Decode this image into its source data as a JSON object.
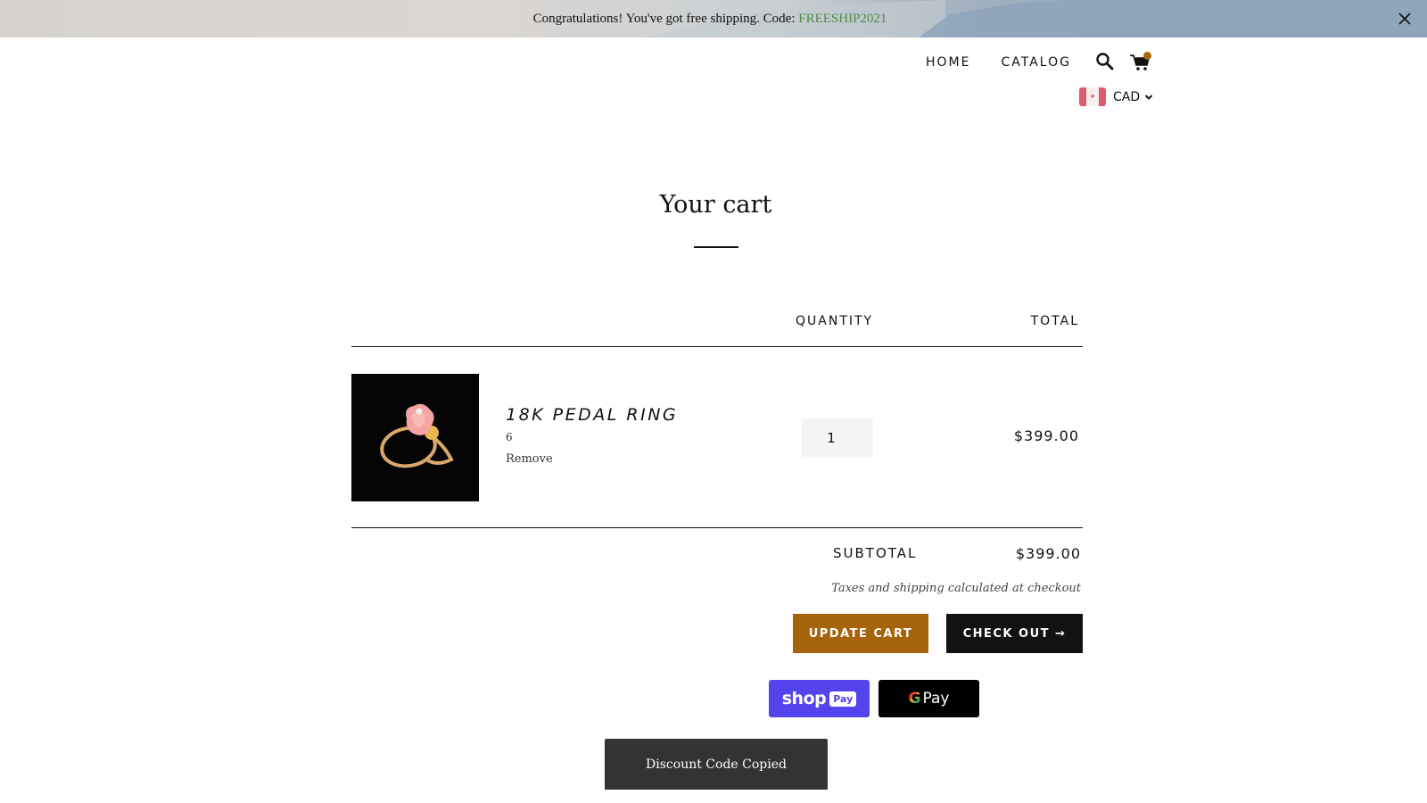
{
  "announcement": {
    "text": "Congratulations! You've got free shipping. Code: ",
    "code": "FREESHIP2021",
    "code_color": "#4f8b45",
    "close_icon": "close-icon"
  },
  "header": {
    "nav": [
      {
        "label": "HOME"
      },
      {
        "label": "CATALOG"
      }
    ],
    "search_icon": "search-icon",
    "cart_icon": "cart-icon",
    "cart_badge_color": "#a9650a",
    "currency": {
      "flag": "canada-flag-icon",
      "selected": "CAD"
    }
  },
  "page": {
    "title": "Your cart"
  },
  "cart": {
    "columns": {
      "quantity": "QUANTITY",
      "total": "TOTAL"
    },
    "items": [
      {
        "name": "18K PEDAL RING",
        "variant": "6",
        "remove_label": "Remove",
        "quantity": "1",
        "total": "$399.00"
      }
    ],
    "subtotal_label": "SUBTOTAL",
    "subtotal_value": "$399.00",
    "tax_note": "Taxes and shipping calculated at checkout",
    "update_label": "UPDATE CART",
    "checkout_label": "CHECK OUT →",
    "update_color": "#a6640a",
    "checkout_color": "#111214"
  },
  "express_pay": {
    "shop_pay": {
      "word": "shop",
      "chip": "Pay",
      "color": "#5444ee"
    },
    "google_pay": {
      "g": "G",
      "word": "Pay"
    }
  },
  "toast": {
    "message": "Discount Code Copied"
  }
}
